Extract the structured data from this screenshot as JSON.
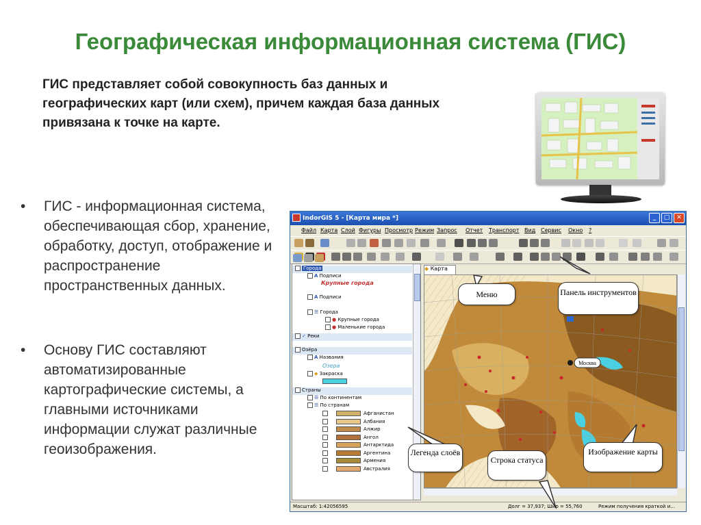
{
  "slide": {
    "title": "Географическая информационная система (ГИС)",
    "definition": "ГИС представляет собой совокупность баз данных и географических карт (или схем), причем каждая база данных привязана к точке на карте.",
    "bullets": [
      {
        "marker": "•",
        "text": "ГИС - информационная система, обеспечивающая сбор, хранение, обработку, доступ, отображение и распространение пространственных данных."
      },
      {
        "marker": "•",
        "text": "Основу ГИС составляют автоматизированные картографические системы, а главными источниками информации служат различные геоизображения."
      }
    ]
  },
  "app": {
    "window_title": "IndorGIS 5 - [Карта мира *]",
    "window_buttons": {
      "minimize": "_",
      "maximize": "□",
      "close": "✕"
    },
    "menu": [
      "Файл",
      "Карта",
      "Слой",
      "Фигуры",
      "Просмотр",
      "Режим",
      "Запрос",
      "Отчет",
      "Транспорт",
      "Вид",
      "Сервис",
      "Окно",
      "?"
    ],
    "map_tab": "Карта",
    "layers": {
      "cities_group": "Города",
      "labels": "Подписи",
      "big_cities_label": "Крупные города",
      "labels2": "Подписи",
      "cities": "Города",
      "big_cities": "Крупные города",
      "small_cities": "Маленькие города",
      "rivers": "Реки",
      "lakes_group": "Озёра",
      "names": "Названия",
      "lake_label": "Озера",
      "fill": "Закраска",
      "countries_group": "Страны",
      "by_continents": "По континентам",
      "by_countries": "По странам",
      "countries": [
        {
          "name": "Афганистан",
          "color": "#d2b26a"
        },
        {
          "name": "Албания",
          "color": "#e6c98a"
        },
        {
          "name": "Алжир",
          "color": "#c08a4a"
        },
        {
          "name": "Ангол",
          "color": "#b2703a"
        },
        {
          "name": "Антарктида",
          "color": "#d8a45a"
        },
        {
          "name": "Аргентина",
          "color": "#b87a2e"
        },
        {
          "name": "Армения",
          "color": "#a78a3a"
        },
        {
          "name": "Австралия",
          "color": "#e3a86c"
        }
      ]
    },
    "map": {
      "city_label": "Москва"
    },
    "status": {
      "scale": "Масштаб: 1:42056595",
      "coords": "Долг = 37,937; Шир = 55,760",
      "mode": "Режим получения краткой и..."
    },
    "callouts": {
      "menu": "Меню",
      "toolbar": "Панель инструментов",
      "legend": "Легенда слоёв",
      "status": "Строка статуса",
      "map_image": "Изображение карты"
    }
  }
}
